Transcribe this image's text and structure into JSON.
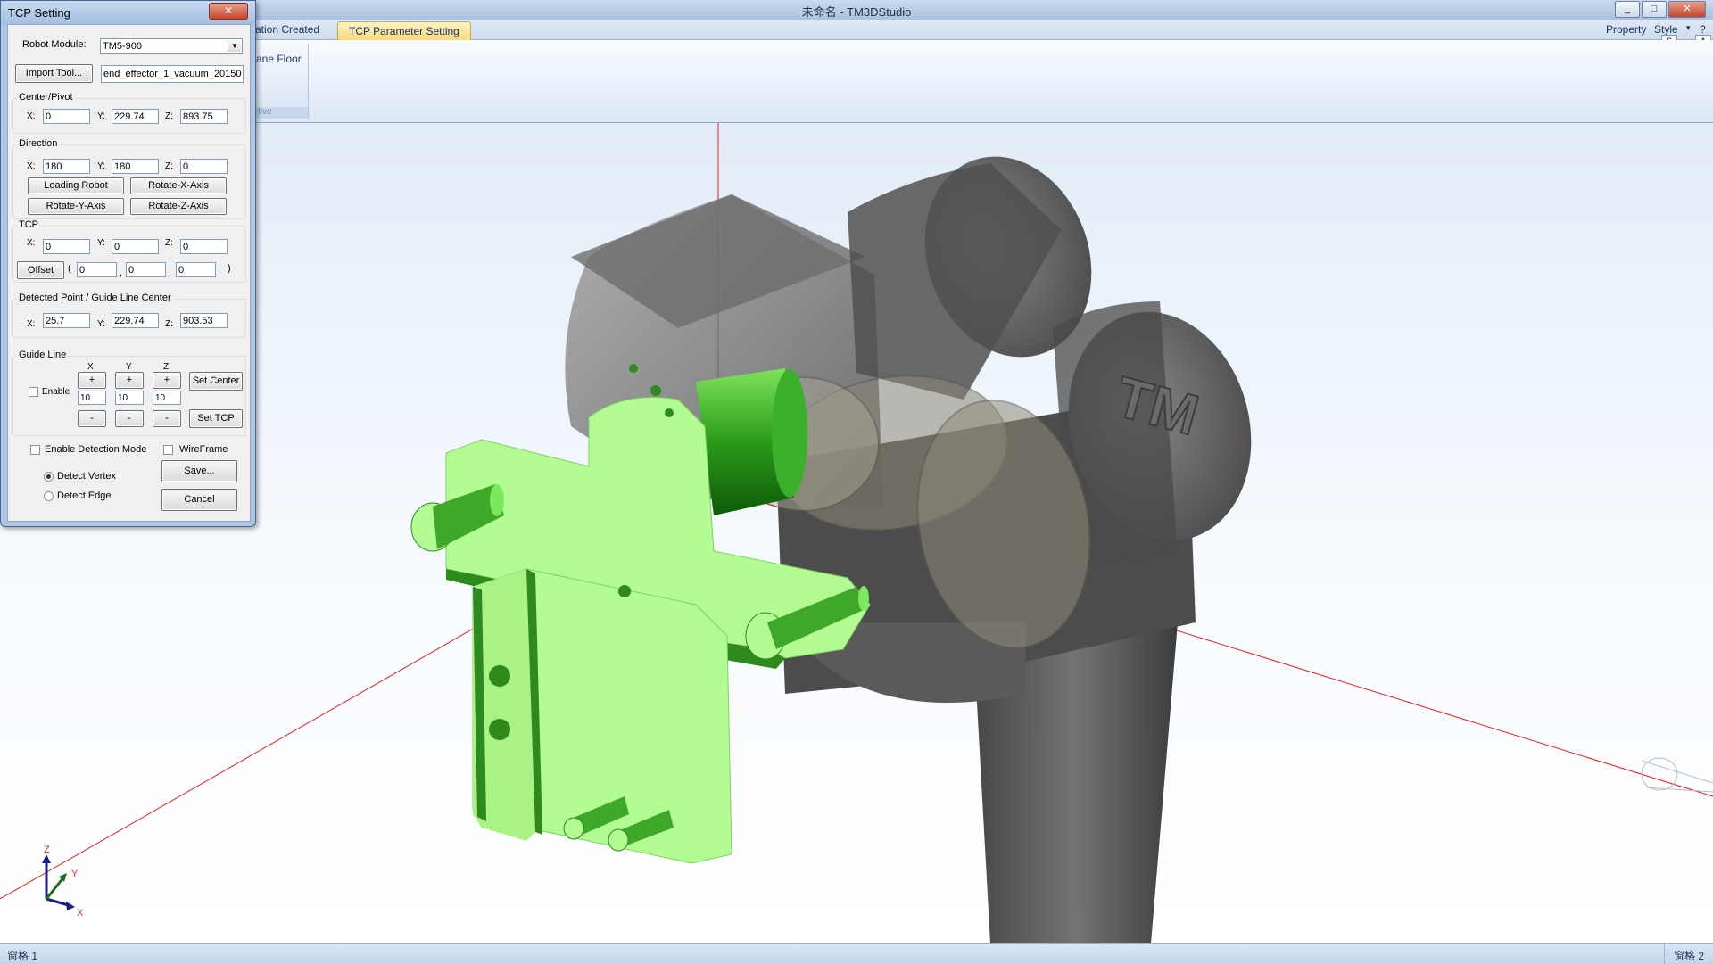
{
  "app": {
    "title": "未命名 - TM3DStudio",
    "ribbon_tabs": [
      "ation Created",
      "TCP Parameter Setting"
    ],
    "right_links": {
      "property": "Property",
      "style": "Style"
    },
    "ribbon_group_item": "ane Floor",
    "ribbon_group_label": "tive",
    "status_left": "窗格 1",
    "status_right": "窗格 2",
    "window_buttons": {
      "min": "_",
      "max": "□",
      "close": "✕"
    },
    "small_boxes": {
      "s": "S",
      "a": "A"
    }
  },
  "dialog": {
    "title": "TCP Setting",
    "close": "✕",
    "robot_module": {
      "label": "Robot Module:",
      "value": "TM5-900"
    },
    "import_tool": {
      "label": "Import Tool...",
      "value": "end_effector_1_vacuum_20150"
    },
    "center_pivot": {
      "title": "Center/Pivot",
      "x": "0",
      "y": "229.74",
      "z": "893.75"
    },
    "direction": {
      "title": "Direction",
      "x": "180",
      "y": "180",
      "z": "0",
      "buttons": [
        "Loading Robot",
        "Rotate-X-Axis",
        "Rotate-Y-Axis",
        "Rotate-Z-Axis"
      ]
    },
    "tcp": {
      "title": "TCP",
      "x": "0",
      "y": "0",
      "z": "0",
      "offset_label": "Offset",
      "offset": [
        "0",
        "0",
        "0"
      ],
      "paren_open": "(",
      "paren_close": ")",
      "comma": ","
    },
    "detected": {
      "title": "Detected Point / Guide Line Center",
      "x": "25.7",
      "y": "229.74",
      "z": "903.53"
    },
    "guide_line": {
      "title": "Guide Line",
      "axes": [
        "X",
        "Y",
        "Z"
      ],
      "enable_label": "Enable",
      "enabled": false,
      "values": [
        "10",
        "10",
        "10"
      ],
      "plus": "+",
      "minus": "-",
      "set_center": "Set Center",
      "set_tcp": "Set TCP"
    },
    "axis_labels": {
      "x": "X:",
      "y": "Y:",
      "z": "Z:"
    },
    "enable_detection_mode": {
      "label": "Enable Detection Mode",
      "checked": false
    },
    "wireframe": {
      "label": "WireFrame",
      "checked": false
    },
    "detect_vertex": {
      "label": "Detect Vertex",
      "selected": true
    },
    "detect_edge": {
      "label": "Detect Edge",
      "selected": false
    },
    "save": "Save...",
    "cancel": "Cancel"
  },
  "axis_triad": {
    "x": "X",
    "y": "Y",
    "z": "Z"
  },
  "robot_logo": "TM",
  "colors": {
    "tool": "#b3fc93",
    "tool_dark": "#2f8a1e",
    "robot": "#5e5e5e",
    "axis_line": "#e02020"
  }
}
